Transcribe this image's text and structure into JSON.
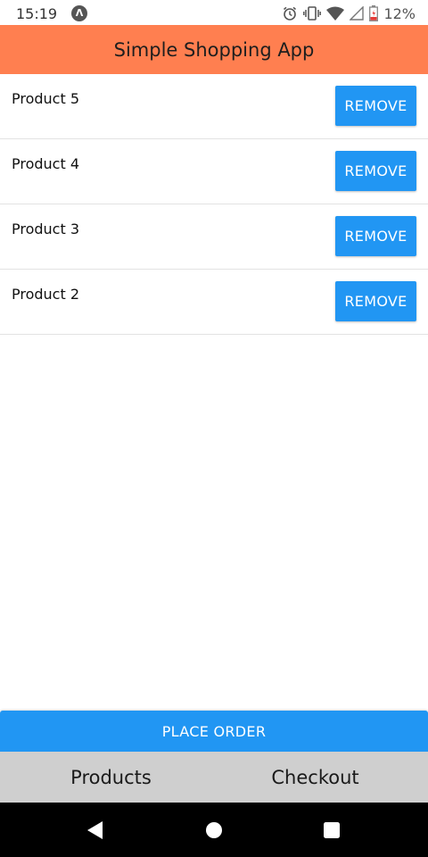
{
  "status_bar": {
    "time": "15:19",
    "app_icon_glyph": "Λ",
    "battery_percent": "12%",
    "icons": [
      "alarm-icon",
      "vibrate-icon",
      "wifi-icon",
      "signal-icon",
      "battery-icon"
    ]
  },
  "app_bar": {
    "title": "Simple Shopping App",
    "color": "#ff7f50"
  },
  "cart": {
    "items": [
      {
        "name": "Product 5",
        "remove_label": "REMOVE"
      },
      {
        "name": "Product 4",
        "remove_label": "REMOVE"
      },
      {
        "name": "Product 3",
        "remove_label": "REMOVE"
      },
      {
        "name": "Product 2",
        "remove_label": "REMOVE"
      }
    ]
  },
  "place_order": {
    "label": "PLACE ORDER",
    "color": "#2196f3"
  },
  "tabs": [
    {
      "label": "Products"
    },
    {
      "label": "Checkout"
    }
  ],
  "nav_bar": {
    "icons": [
      "back-icon",
      "home-icon",
      "recents-icon"
    ]
  }
}
